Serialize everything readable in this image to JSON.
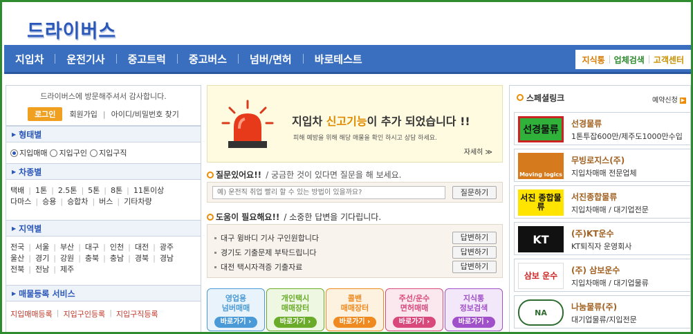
{
  "logo": "드라이버스",
  "gnb": {
    "items": [
      "지입차",
      "운전기사",
      "중고트럭",
      "중고버스",
      "넘버/면허",
      "바로테스트"
    ],
    "right": [
      "지식통",
      "업체검색",
      "고객센터"
    ]
  },
  "login": {
    "welcome": "드라이버스에 방문해주셔서 감사합니다.",
    "login_button": "로그인",
    "signup": "회원가입",
    "find": "아이디/비밀번호 찾기"
  },
  "sections": {
    "type": {
      "title": "형태별",
      "options": [
        "지입매매",
        "지입구인",
        "지입구직"
      ]
    },
    "vehicle": {
      "title": "차종별",
      "row1": [
        "택배",
        "1톤",
        "2.5톤",
        "5톤",
        "8톤",
        "11톤이상"
      ],
      "row2": [
        "다마스",
        "승용",
        "승합차",
        "버스",
        "기타차량"
      ]
    },
    "region": {
      "title": "지역별",
      "row1": [
        "전국",
        "서울",
        "부산",
        "대구",
        "인천",
        "대전",
        "광주"
      ],
      "row2": [
        "울산",
        "경기",
        "강원",
        "충북",
        "충남",
        "경북",
        "경남"
      ],
      "row3": [
        "전북",
        "전남",
        "제주"
      ]
    },
    "register": {
      "title": "매물등록 서비스",
      "links": [
        "지입매매등록",
        "지입구인등록",
        "지입구직등록"
      ]
    }
  },
  "banner": {
    "headline_pre": "지입차 ",
    "headline_hl": "신고기능",
    "headline_post": "이 추가 되었습니다 !!",
    "sub": "피해 예방을 위해 해당 매물을 확인 하시고 상담 하세요.",
    "more": "자세히 ≫"
  },
  "question": {
    "title": "질문있어요!!",
    "desc": "/ 궁금한 것이 있다면 질문을 해 보세요.",
    "placeholder": "예) 운전직 취업 빨리 할 수 있는 방법이 있을까요?",
    "button": "질문하기"
  },
  "help": {
    "title": "도움이 필요해요!!",
    "desc": "/ 소중한 답변을 기다립니다.",
    "items": [
      {
        "text": "대구 윙바디 기사 구인원합니다",
        "button": "답변하기"
      },
      {
        "text": "경기도 기출문제 부탁드립니다",
        "button": "답변하기"
      },
      {
        "text": "대전 택시자격증 기출자료",
        "button": "답변하기"
      }
    ]
  },
  "services": [
    {
      "line1": "영업용",
      "line2": "넘버매매",
      "button": "바로가기 ›",
      "color": "#4a9ad8",
      "bg": "#e8f3fb"
    },
    {
      "line1": "개인택시",
      "line2": "매매장터",
      "button": "바로가기 ›",
      "color": "#6aab2a",
      "bg": "#eef7e2"
    },
    {
      "line1": "콜밴",
      "line2": "매매장터",
      "button": "바로가기 ›",
      "color": "#ee8a20",
      "bg": "#fdf1e0"
    },
    {
      "line1": "주선/운수",
      "line2": "면허매매",
      "button": "바로가기 ›",
      "color": "#d8487a",
      "bg": "#fbe8ef"
    },
    {
      "line1": "지식통",
      "line2": "정보검색",
      "button": "바로가기 ›",
      "color": "#a050c8",
      "bg": "#f3e8fa"
    }
  ],
  "special": {
    "title": "스페셜링크",
    "reserve": "예약신청",
    "items": [
      {
        "logo": "선경물류",
        "name": "선경물류",
        "desc": "1톤투잡600만/제주도1000만수입"
      },
      {
        "logo": "Moving logics",
        "name": "무빙로지스(주)",
        "desc": "지입차매매 전문업체"
      },
      {
        "logo": "서진 종합물류",
        "name": "서진종합물류",
        "desc": "지입차매매 / 대기업전문"
      },
      {
        "logo": "KT",
        "name": "(주)KT운수",
        "desc": "KT퇴직자 운영회사"
      },
      {
        "logo": "삼보 운수",
        "name": "(주) 삼보운수",
        "desc": "지입차매매 / 대기업물류"
      },
      {
        "logo": "NA",
        "name": "나눔물류(주)",
        "desc": "대기업물류/지입전문"
      }
    ]
  }
}
